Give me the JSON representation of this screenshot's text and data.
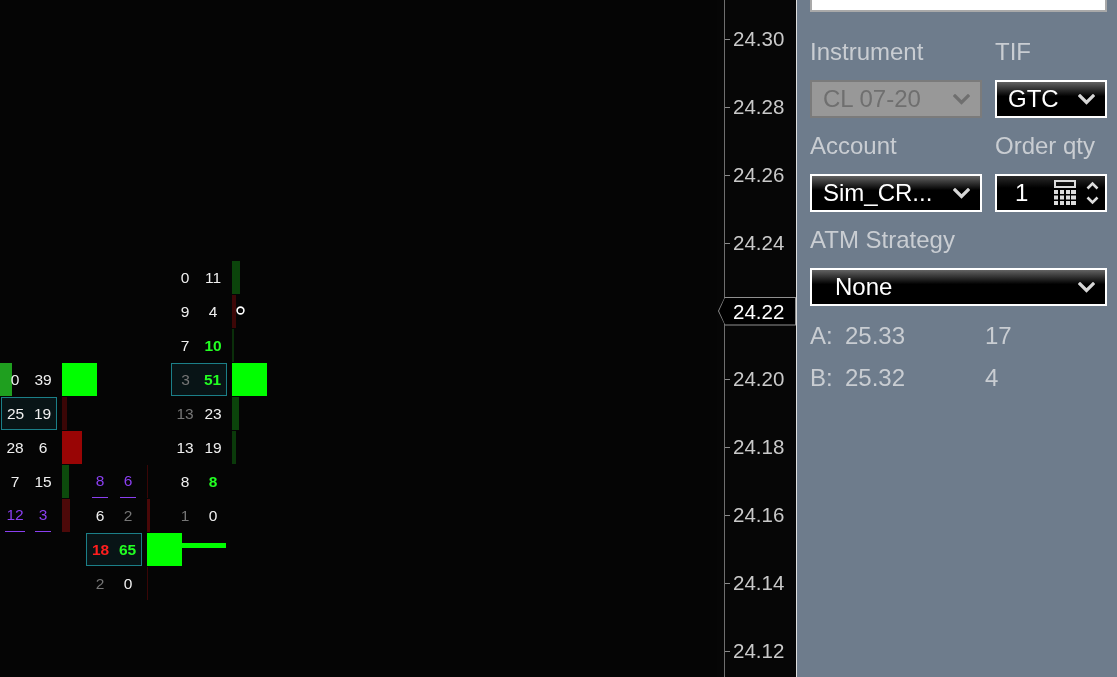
{
  "footprint": {
    "bars": [
      {
        "levels": [
          {
            "delta_bar": {
              "color": "#1f9f1f"
            }
          }
        ]
      },
      {
        "levels": [
          {
            "bid": {
              "text": "0",
              "kind": "plain"
            },
            "ask": {
              "text": "39",
              "kind": "plain"
            },
            "poc": false,
            "delta_bar": {
              "color": "#00ff00"
            }
          },
          {
            "bid": {
              "text": "25",
              "kind": "plain"
            },
            "ask": {
              "text": "19",
              "kind": "plain"
            },
            "poc": true,
            "delta_bar": {
              "color": "#3a0606"
            }
          },
          {
            "bid": {
              "text": "28",
              "kind": "plain"
            },
            "ask": {
              "text": "6",
              "kind": "plain"
            },
            "poc": false,
            "delta_bar": {
              "color": "#990505"
            }
          },
          {
            "bid": {
              "text": "7",
              "kind": "plain"
            },
            "ask": {
              "text": "15",
              "kind": "plain"
            },
            "poc": false,
            "delta_bar": {
              "color": "#0c4a0c"
            }
          },
          {
            "bid": {
              "text": "12",
              "kind": "marked"
            },
            "ask": {
              "text": "3",
              "kind": "marked"
            },
            "poc": false,
            "delta_bar": {
              "color": "#4d0909"
            }
          }
        ]
      },
      {
        "levels": [
          {
            "bid": {
              "text": "8",
              "kind": "marked"
            },
            "ask": {
              "text": "6",
              "kind": "marked"
            },
            "poc": false,
            "delta_bar": {
              "color": "#3a0606"
            }
          },
          {
            "bid": {
              "text": "6",
              "kind": "plain"
            },
            "ask": {
              "text": "2",
              "kind": "muted"
            },
            "poc": false,
            "delta_bar": {
              "color": "#4a0808"
            }
          },
          {
            "bid": {
              "text": "18",
              "kind": "imbalance"
            },
            "ask": {
              "text": "65",
              "kind": "imbalance"
            },
            "poc": true,
            "delta_bar": {
              "color": "#00ff00"
            },
            "marker": {
              "kind": "line"
            }
          },
          {
            "bid": {
              "text": "2",
              "kind": "muted"
            },
            "ask": {
              "text": "0",
              "kind": "plain"
            },
            "poc": false,
            "delta_bar": {
              "color": "#3a0606"
            }
          }
        ]
      },
      {
        "levels": [
          {
            "bid": {
              "text": "0",
              "kind": "plain"
            },
            "ask": {
              "text": "11",
              "kind": "plain"
            },
            "poc": false,
            "delta_bar": {
              "color": "#0b440b"
            }
          },
          {
            "bid": {
              "text": "9",
              "kind": "plain"
            },
            "ask": {
              "text": "4",
              "kind": "plain"
            },
            "poc": false,
            "delta_bar": {
              "color": "#3d0707"
            },
            "marker": {
              "kind": "ring"
            }
          },
          {
            "bid": {
              "text": "7",
              "kind": "plain"
            },
            "ask": {
              "text": "10",
              "kind": "imbalance"
            },
            "poc": false,
            "delta_bar": {
              "color": "#0a2f0a"
            }
          },
          {
            "bid": {
              "text": "3",
              "kind": "muted"
            },
            "ask": {
              "text": "51",
              "kind": "imbalance"
            },
            "poc": true,
            "delta_bar": {
              "color": "#00ff00"
            }
          },
          {
            "bid": {
              "text": "13",
              "kind": "muted"
            },
            "ask": {
              "text": "23",
              "kind": "plain"
            },
            "poc": false,
            "delta_bar": {
              "color": "#0b440b"
            }
          },
          {
            "bid": {
              "text": "13",
              "kind": "plain"
            },
            "ask": {
              "text": "19",
              "kind": "plain"
            },
            "poc": false,
            "delta_bar": {
              "color": "#0a3a0a"
            }
          },
          {
            "bid": {
              "text": "8",
              "kind": "plain"
            },
            "ask": {
              "text": "8",
              "kind": "imbalance"
            },
            "poc": false
          },
          {
            "bid": {
              "text": "1",
              "kind": "muted"
            },
            "ask": {
              "text": "0",
              "kind": "plain"
            },
            "poc": false
          }
        ]
      }
    ]
  },
  "price_axis": {
    "labels": [
      {
        "text": "24.30",
        "current": false
      },
      {
        "text": "24.28",
        "current": false
      },
      {
        "text": "24.26",
        "current": false
      },
      {
        "text": "24.24",
        "current": false
      },
      {
        "text": "24.22",
        "current": true
      },
      {
        "text": "24.20",
        "current": false
      },
      {
        "text": "24.18",
        "current": false
      },
      {
        "text": "24.16",
        "current": false
      },
      {
        "text": "24.14",
        "current": false
      },
      {
        "text": "24.12",
        "current": false
      }
    ]
  },
  "order_entry": {
    "rows": [
      {
        "fields": [
          {
            "label": "Instrument",
            "kind": "select",
            "value": "CL 07-20",
            "disabled": true
          },
          {
            "label": "TIF",
            "kind": "select",
            "value": "GTC",
            "disabled": false
          }
        ]
      },
      {
        "fields": [
          {
            "label": "Account",
            "kind": "select",
            "value": "Sim_CR...",
            "disabled": false
          },
          {
            "label": "Order qty",
            "kind": "quantity",
            "value": "1",
            "disabled": false
          }
        ]
      },
      {
        "fields": [
          {
            "label": "ATM Strategy",
            "kind": "select",
            "value": "None",
            "disabled": false
          }
        ]
      }
    ],
    "quotes": [
      {
        "side": "A:",
        "price": "25.33",
        "size": "17"
      },
      {
        "side": "B:",
        "price": "25.32",
        "size": "4"
      }
    ]
  }
}
